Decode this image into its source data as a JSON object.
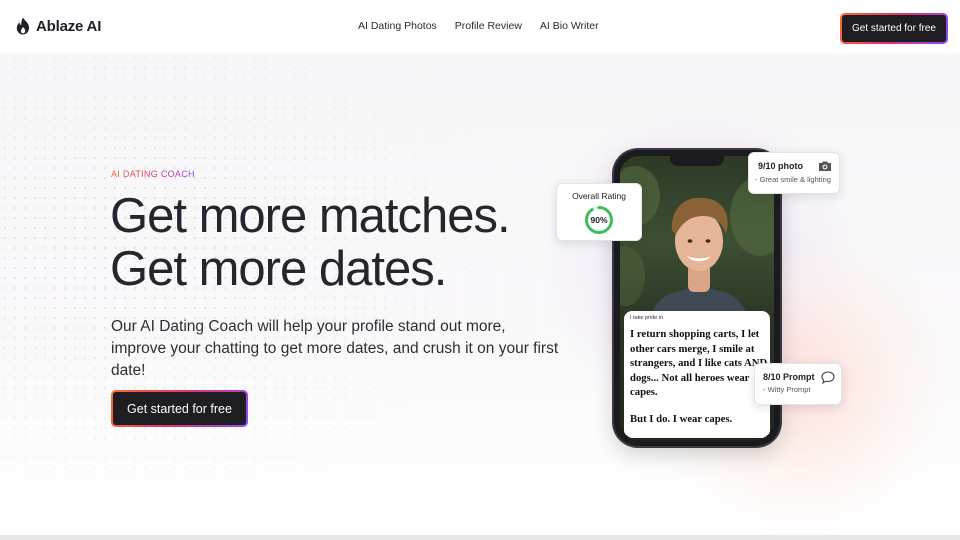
{
  "brand": {
    "name": "Ablaze AI"
  },
  "nav": {
    "links": [
      "AI Dating Photos",
      "Profile Review",
      "AI Bio Writer"
    ],
    "cta": "Get started for free"
  },
  "hero": {
    "eyebrow": "AI DATING COACH",
    "headline_line1": "Get more matches.",
    "headline_line2": "Get more dates.",
    "subtitle": "Our AI Dating Coach will help your profile stand out more, improve your chatting to get more dates, and crush it on your first date!",
    "cta": "Get started for free"
  },
  "phone": {
    "prompt_label": "I take pride in",
    "prompt_text": "I return shopping carts, I let other cars merge, I smile at strangers, and I like cats AND dogs... Not all heroes wear capes.",
    "prompt_text2": "But I do. I wear capes."
  },
  "cards": {
    "overall": {
      "title": "Overall Rating",
      "value": "90%",
      "fraction": 0.9
    },
    "photo": {
      "title": "9/10 photo",
      "subtitle": "- Great smile & lighting"
    },
    "prompt": {
      "title": "8/10 Prompt",
      "subtitle": "- Witty Prompt"
    }
  },
  "icons": {
    "logo": "flame-icon",
    "photo": "camera-icon",
    "prompt": "chat-bubble-icon"
  },
  "colors": {
    "accent_orange": "#f2643a",
    "accent_pink": "#d8386e",
    "accent_purple": "#8f45e6",
    "ring_green": "#3fbf5c",
    "button_dark": "#1d1d22"
  }
}
